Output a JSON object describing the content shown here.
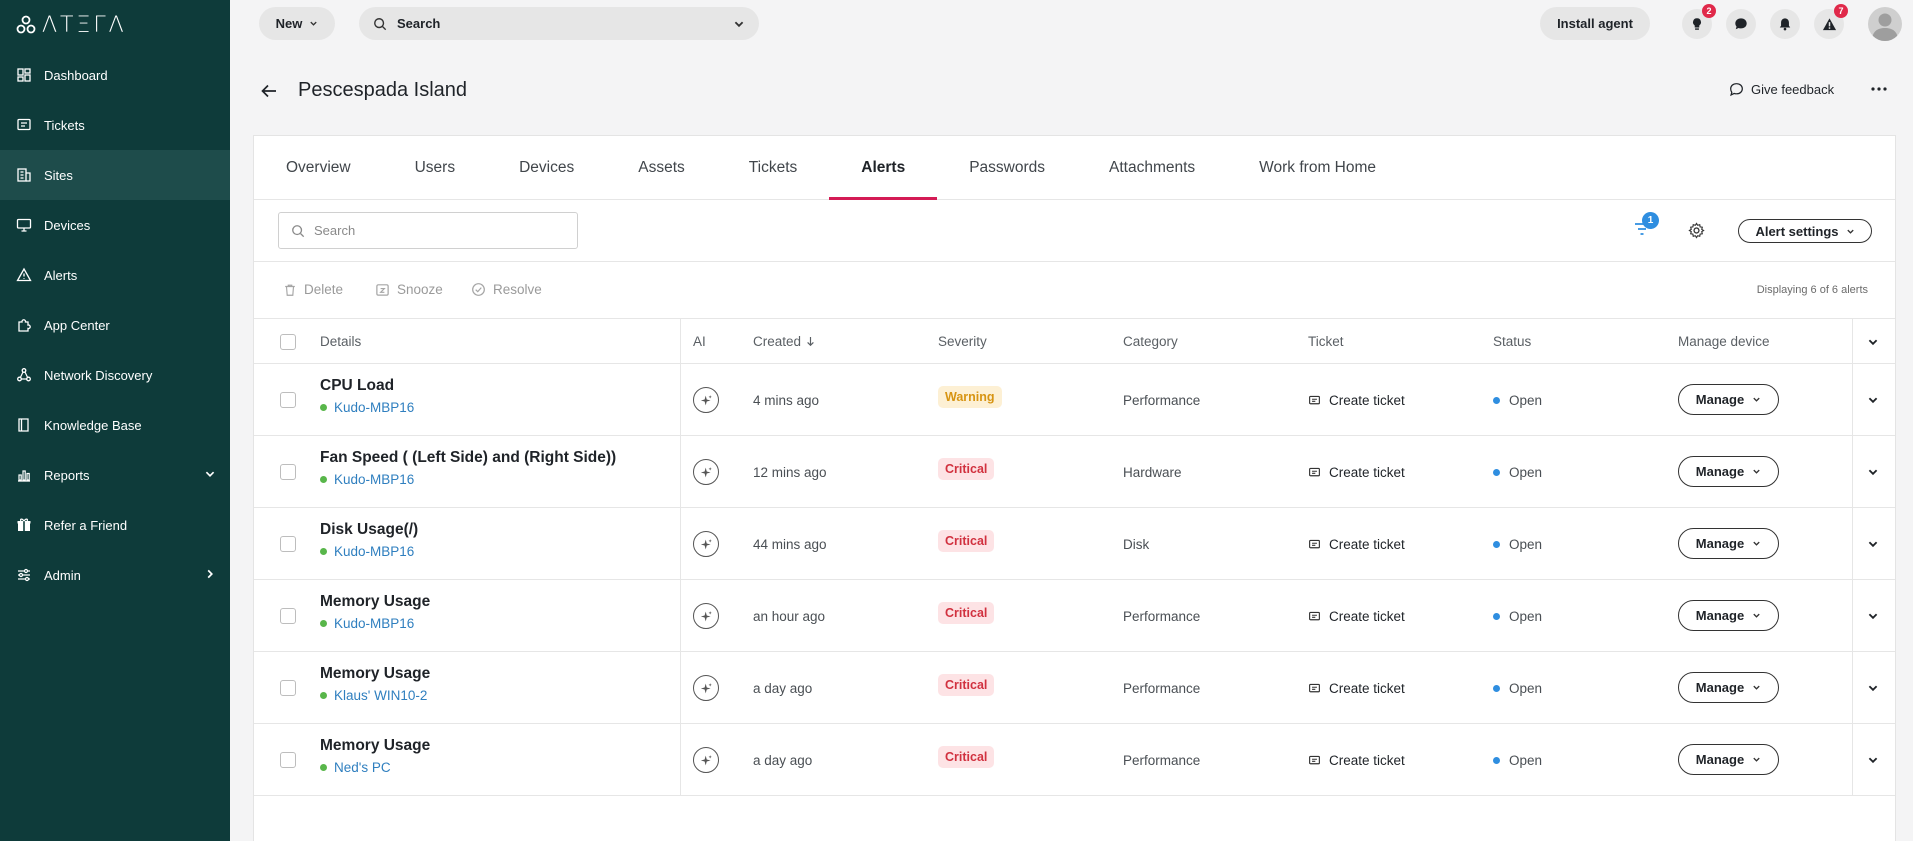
{
  "brand": {
    "logo_text": "ΛΤΞΓΛ"
  },
  "sidebar": {
    "items": [
      {
        "label": "Dashboard",
        "icon": "dashboard-icon",
        "active": false
      },
      {
        "label": "Tickets",
        "icon": "ticket-icon",
        "active": false
      },
      {
        "label": "Sites",
        "icon": "building-icon",
        "active": true
      },
      {
        "label": "Devices",
        "icon": "monitor-icon",
        "active": false
      },
      {
        "label": "Alerts",
        "icon": "warning-icon",
        "active": false
      },
      {
        "label": "App Center",
        "icon": "puzzle-icon",
        "active": false
      },
      {
        "label": "Network Discovery",
        "icon": "network-icon",
        "active": false
      },
      {
        "label": "Knowledge Base",
        "icon": "book-icon",
        "active": false
      },
      {
        "label": "Reports",
        "icon": "chart-icon",
        "active": false
      },
      {
        "label": "Refer a Friend",
        "icon": "gift-icon",
        "active": false
      },
      {
        "label": "Admin",
        "icon": "sliders-icon",
        "active": false
      }
    ]
  },
  "topbar": {
    "new_label": "New",
    "search_label": "Search",
    "install_label": "Install agent",
    "ideas_badge": "2",
    "alerts_badge": "7"
  },
  "page": {
    "title": "Pescespada Island",
    "feedback_label": "Give feedback"
  },
  "tabs": [
    "Overview",
    "Users",
    "Devices",
    "Assets",
    "Tickets",
    "Alerts",
    "Passwords",
    "Attachments",
    "Work from Home"
  ],
  "active_tab": "Alerts",
  "toolbar": {
    "search_placeholder": "Search",
    "filter_count": "1",
    "alert_settings_label": "Alert settings"
  },
  "actions": {
    "delete_label": "Delete",
    "snooze_label": "Snooze",
    "resolve_label": "Resolve",
    "displaying_text": "Displaying 6 of 6 alerts"
  },
  "table": {
    "headers": {
      "details": "Details",
      "ai": "AI",
      "created": "Created",
      "severity": "Severity",
      "category": "Category",
      "ticket": "Ticket",
      "status": "Status",
      "manage": "Manage device"
    },
    "rows": [
      {
        "title": "CPU Load",
        "device": "Kudo-MBP16",
        "created": "4 mins ago",
        "severity": "Warning",
        "category": "Performance",
        "ticket": "Create ticket",
        "status": "Open",
        "manage": "Manage"
      },
      {
        "title": "Fan Speed ( (Left Side) and (Right Side))",
        "device": "Kudo-MBP16",
        "created": "12 mins ago",
        "severity": "Critical",
        "category": "Hardware",
        "ticket": "Create ticket",
        "status": "Open",
        "manage": "Manage"
      },
      {
        "title": "Disk Usage(/)",
        "device": "Kudo-MBP16",
        "created": "44 mins ago",
        "severity": "Critical",
        "category": "Disk",
        "ticket": "Create ticket",
        "status": "Open",
        "manage": "Manage"
      },
      {
        "title": "Memory Usage",
        "device": "Kudo-MBP16",
        "created": "an hour ago",
        "severity": "Critical",
        "category": "Performance",
        "ticket": "Create ticket",
        "status": "Open",
        "manage": "Manage"
      },
      {
        "title": "Memory Usage",
        "device": "Klaus' WIN10-2",
        "created": "a day ago",
        "severity": "Critical",
        "category": "Performance",
        "ticket": "Create ticket",
        "status": "Open",
        "manage": "Manage"
      },
      {
        "title": "Memory Usage",
        "device": "Ned's PC",
        "created": "a day ago",
        "severity": "Critical",
        "category": "Performance",
        "ticket": "Create ticket",
        "status": "Open",
        "manage": "Manage"
      }
    ]
  },
  "colors": {
    "sidebar_bg": "#0e3b3a",
    "accent_tab": "#d41b55",
    "link": "#2f7fbf",
    "warning": "#d79412",
    "critical": "#d1313f"
  }
}
